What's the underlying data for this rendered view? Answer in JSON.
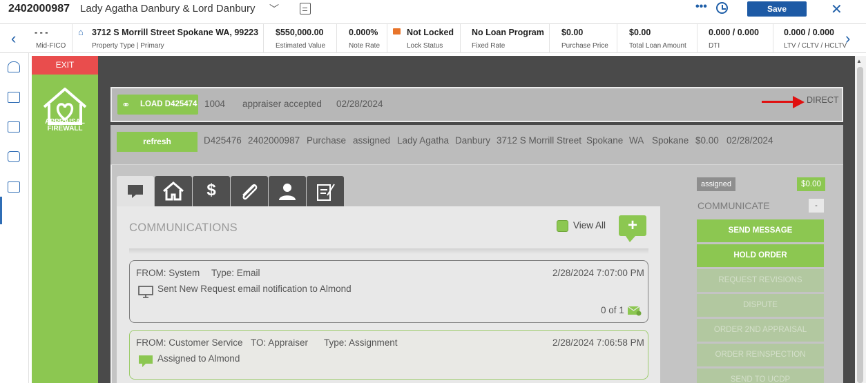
{
  "header": {
    "loan_number": "2402000987",
    "borrower": "Lady Agatha Danbury & Lord Danbury",
    "save_label": "Save",
    "more_label": "•••"
  },
  "infobar": {
    "mid_fico_value": "- - -",
    "mid_fico_label": "Mid-FICO",
    "address_value": "3712 S Morrill Street Spokane WA, 99223",
    "address_label": "Property Type | Primary",
    "estimated_value": "$550,000.00",
    "estimated_label": "Estimated Value",
    "note_rate_value": "0.000%",
    "note_rate_label": "Note Rate",
    "lock_value": "Not Locked",
    "lock_label": "Lock Status",
    "program_value": "No Loan Program",
    "program_label": "Fixed Rate",
    "purchase_value": "$0.00",
    "purchase_label": "Purchase Price",
    "total_loan_value": "$0.00",
    "total_loan_label": "Total Loan Amount",
    "dti_value": "0.000 / 0.000",
    "dti_label": "DTI",
    "ltv_value": "0.000 / 0.000",
    "ltv_label": "LTV / CLTV / HCLTV"
  },
  "app": {
    "exit_label": "EXIT",
    "logo_line1": "APPRAISAL",
    "logo_line2": "FIREWALL"
  },
  "load_row": {
    "load_label": "LOAD D425474",
    "number": "1004",
    "status": "appraiser accepted",
    "date": "02/28/2024",
    "channel": "DIRECT"
  },
  "detail": {
    "refresh_label": "refresh",
    "fields": [
      "D425476",
      "2402000987",
      "Purchase",
      "assigned",
      "Lady Agatha",
      "Danbury",
      "3712 S Morrill Street",
      "Spokane",
      "WA",
      "Spokane",
      "$0.00",
      "02/28/2024"
    ]
  },
  "communications": {
    "title": "COMMUNICATIONS",
    "view_all": "View All",
    "add": "+",
    "messages": [
      {
        "from": "FROM: System",
        "type": "Type: Email",
        "timestamp": "2/28/2024 7:07:00 PM",
        "body": "Sent New Request email notification to Almond",
        "count": "0 of 1"
      },
      {
        "from": "FROM: Customer Service",
        "to": "TO: Appraiser",
        "type": "Type: Assignment",
        "timestamp": "2/28/2024 7:06:58 PM",
        "body": "Assigned to Almond"
      }
    ]
  },
  "right_panel": {
    "status_badge": "assigned",
    "amount_badge": "$0.00",
    "section_title": "COMMUNICATE",
    "collapse": "-",
    "actions": [
      "SEND MESSAGE",
      "HOLD ORDER",
      "REQUEST REVISIONS",
      "DISPUTE",
      "ORDER 2ND APPRAISAL",
      "ORDER REINSPECTION",
      "SEND TO UCDP"
    ]
  },
  "colors": {
    "accent_green": "#8cc751",
    "exit_red": "#e94d4d",
    "save_blue": "#1d5aa5"
  }
}
